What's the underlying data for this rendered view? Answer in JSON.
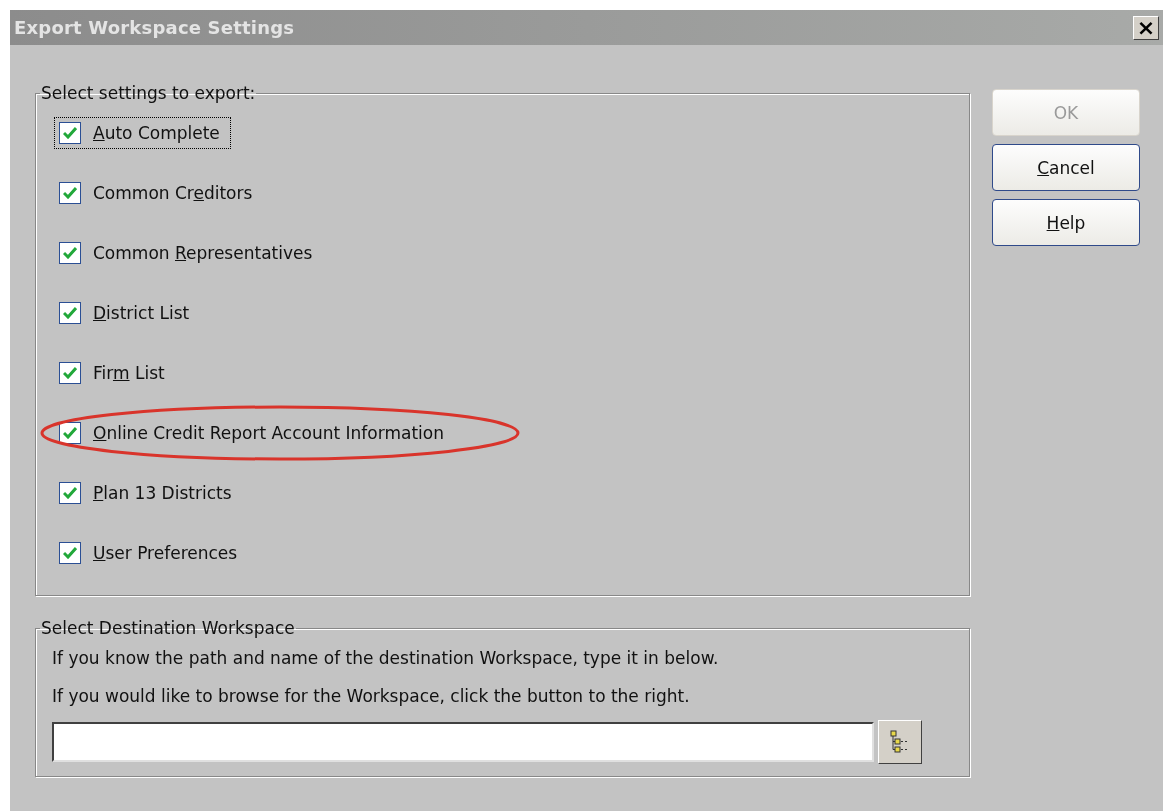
{
  "window": {
    "title": "Export Workspace Settings",
    "close": "×"
  },
  "settings_group": {
    "legend": "Select settings to export:",
    "items": [
      {
        "key": "A",
        "post": "uto Complete",
        "checked": true,
        "focused": true,
        "circled": false
      },
      {
        "pre": "Common Cr",
        "key": "e",
        "post": "ditors",
        "checked": true,
        "focused": false,
        "circled": false
      },
      {
        "pre": "Common ",
        "key": "R",
        "post": "epresentatives",
        "checked": true,
        "focused": false,
        "circled": false
      },
      {
        "key": "D",
        "post": "istrict List",
        "checked": true,
        "focused": false,
        "circled": false
      },
      {
        "pre": "Fir",
        "key": "m",
        "post": " List",
        "checked": true,
        "focused": false,
        "circled": false
      },
      {
        "key": "O",
        "post": "nline Credit Report Account Information",
        "checked": true,
        "focused": false,
        "circled": true
      },
      {
        "key": "P",
        "post": "lan 13 Districts",
        "checked": true,
        "focused": false,
        "circled": false
      },
      {
        "key": "U",
        "post": "ser Preferences",
        "checked": true,
        "focused": false,
        "circled": false
      }
    ]
  },
  "buttons": [
    {
      "pre": "OK",
      "disabled": true
    },
    {
      "key": "C",
      "post": "ancel",
      "disabled": false
    },
    {
      "key": "H",
      "post": "elp",
      "disabled": false
    }
  ],
  "destination_group": {
    "legend": "Select Destination Workspace",
    "lines": [
      "If you know the path and name of the destination Workspace, type it in below.",
      "If you would like to browse for the Workspace, click the button to the right."
    ]
  }
}
